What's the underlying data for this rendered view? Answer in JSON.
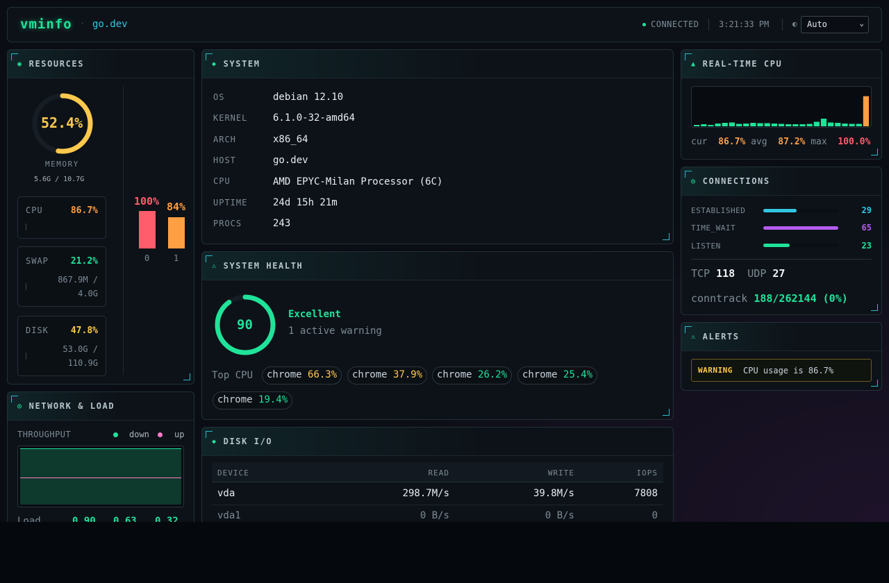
{
  "header": {
    "brand": "vminfo",
    "separator": "·",
    "host": "go.dev",
    "status": "CONNECTED",
    "clock": "3:21:33 PM",
    "theme_icon": "half-circle-icon",
    "theme_selected": "Auto"
  },
  "resources": {
    "title": "RESOURCES",
    "memory": {
      "percent": 52.4,
      "percent_label": "52.4%",
      "label": "MEMORY",
      "usage": "5.6G / 10.7G"
    },
    "cpu": {
      "label": "CPU",
      "percent_label": "86.7%"
    },
    "swap": {
      "label": "SWAP",
      "percent_label": "21.2%",
      "usage_line1": "867.9M /",
      "usage_line2": "4.0G"
    },
    "disk": {
      "label": "DISK",
      "percent_label": "47.8%",
      "usage_line1": "53.0G /",
      "usage_line2": "110.9G"
    },
    "cores": [
      {
        "id": "0",
        "percent": 100,
        "label": "100%",
        "color": "#ff5c6c"
      },
      {
        "id": "1",
        "percent": 84,
        "label": "84%",
        "color": "#ff9f43"
      }
    ]
  },
  "system": {
    "title": "SYSTEM",
    "rows": [
      {
        "key": "OS",
        "value": "debian 12.10"
      },
      {
        "key": "KERNEL",
        "value": "6.1.0-32-amd64"
      },
      {
        "key": "ARCH",
        "value": "x86_64"
      },
      {
        "key": "HOST",
        "value": "go.dev"
      },
      {
        "key": "CPU",
        "value": "AMD EPYC-Milan Processor (6C)"
      },
      {
        "key": "UPTIME",
        "value": "24d 15h 21m"
      },
      {
        "key": "PROCS",
        "value": "243"
      }
    ]
  },
  "health": {
    "title": "SYSTEM HEALTH",
    "score": 90,
    "score_label": "90",
    "status": "Excellent",
    "warnings": "1 active warning",
    "top_cpu_label": "Top CPU",
    "top_cpu": [
      {
        "name": "chrome",
        "value": "66.3%",
        "color": "#ffc94d"
      },
      {
        "name": "chrome",
        "value": "37.9%",
        "color": "#ffc94d"
      },
      {
        "name": "chrome",
        "value": "26.2%",
        "color": "#20e39a"
      },
      {
        "name": "chrome",
        "value": "25.4%",
        "color": "#20e39a"
      },
      {
        "name": "chrome",
        "value": "19.4%",
        "color": "#20e39a"
      }
    ]
  },
  "disk_io": {
    "title": "DISK I/O",
    "columns": [
      "DEVICE",
      "READ",
      "WRITE",
      "IOPS"
    ],
    "rows": [
      {
        "device": "vda",
        "read": "298.7M/s",
        "write": "39.8M/s",
        "iops": "7808"
      },
      {
        "device": "vda1",
        "read": "0 B/s",
        "write": "0 B/s",
        "iops": "0"
      }
    ]
  },
  "network": {
    "title": "NETWORK & LOAD",
    "throughput_label": "THROUGHPUT",
    "legend_down": "down",
    "legend_up": "up",
    "down_color": "#20e39a",
    "up_color": "#ff7ac6",
    "load_label": "Load",
    "load": [
      "0.90",
      "0.63",
      "0.32"
    ]
  },
  "realtime_cpu": {
    "title": "REAL-TIME CPU",
    "history": [
      4,
      6,
      4,
      8,
      10,
      11,
      7,
      8,
      10,
      9,
      9,
      8,
      7,
      6,
      6,
      6,
      7,
      13,
      22,
      11,
      10,
      8,
      7,
      7,
      86.7
    ],
    "cur_label": "cur",
    "cur": "86.7%",
    "avg_label": "avg",
    "avg": "87.2%",
    "max_label": "max",
    "max": "100.0%"
  },
  "connections": {
    "title": "CONNECTIONS",
    "states": [
      {
        "label": "ESTABLISHED",
        "value": 29,
        "value_label": "29",
        "color": "#33c6e4"
      },
      {
        "label": "TIME_WAIT",
        "value": 65,
        "value_label": "65",
        "color": "#b65cf0"
      },
      {
        "label": "LISTEN",
        "value": 23,
        "value_label": "23",
        "color": "#20e39a"
      }
    ],
    "tcp_label": "TCP",
    "tcp": "118",
    "udp_label": "UDP",
    "udp": "27",
    "conntrack_label": "conntrack",
    "conntrack": "188/262144 (0%)"
  },
  "alerts": {
    "title": "ALERTS",
    "items": [
      {
        "level": "WARNING",
        "message": "CPU usage is 86.7%"
      }
    ]
  }
}
